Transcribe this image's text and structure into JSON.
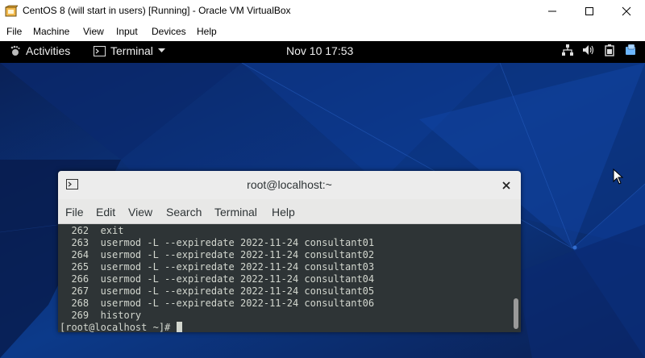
{
  "window": {
    "title": "CentOS 8 (will start in users) [Running] - Oracle VM VirtualBox",
    "icon": "virtualbox-icon",
    "controls": [
      "minimize-icon",
      "maximize-icon",
      "close-icon"
    ]
  },
  "vbox_menu": [
    "File",
    "Machine",
    "View",
    "Input",
    "Devices",
    "Help"
  ],
  "gnome": {
    "activities": "Activities",
    "app_menu": "Terminal",
    "clock": "Nov 10  17:53",
    "tray_icons": [
      "network-icon",
      "volume-icon",
      "battery-icon",
      "notification-icon"
    ]
  },
  "terminal": {
    "title": "root@localhost:~",
    "menu": [
      "File",
      "Edit",
      "View",
      "Search",
      "Terminal",
      "Help"
    ],
    "lines": [
      "  262  exit",
      "  263  usermod -L --expiredate 2022-11-24 consultant01",
      "  264  usermod -L --expiredate 2022-11-24 consultant02",
      "  265  usermod -L --expiredate 2022-11-24 consultant03",
      "  266  usermod -L --expiredate 2022-11-24 consultant04",
      "  267  usermod -L --expiredate 2022-11-24 consultant05",
      "  268  usermod -L --expiredate 2022-11-24 consultant06",
      "  269  history"
    ],
    "prompt": "[root@localhost ~]# "
  },
  "colors": {
    "desktop_bg": "#0b2a6b",
    "terminal_bg": "#2e3436",
    "terminal_fg": "#d3d7cf",
    "gnome_bar": "#000000"
  }
}
